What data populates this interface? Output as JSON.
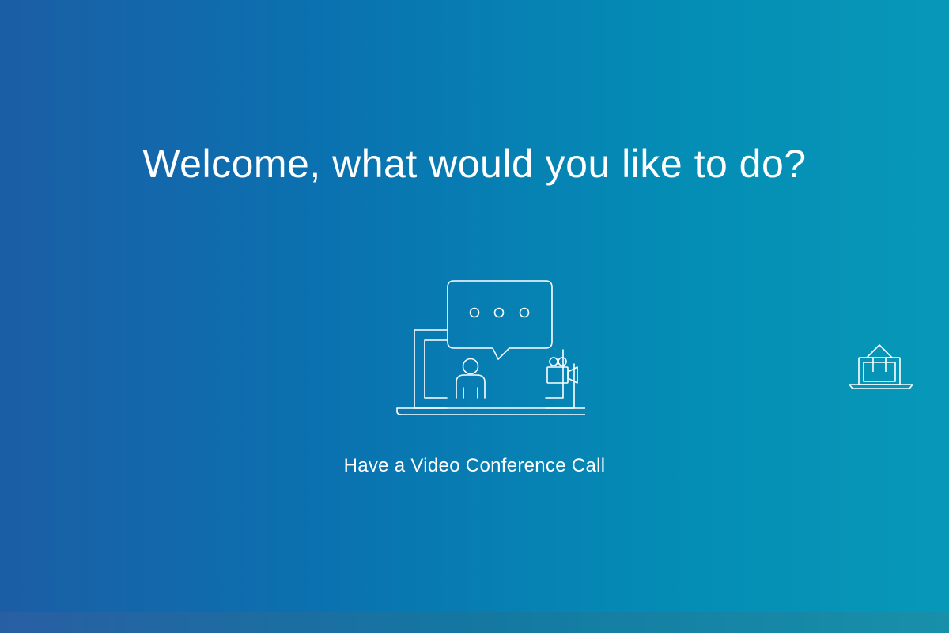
{
  "welcome": {
    "title": "Welcome, what would you like to do?"
  },
  "options": [
    {
      "label": "Have a Video Conference Call",
      "icon": "video-conference-icon"
    },
    {
      "label": "",
      "icon": "share-screen-icon"
    }
  ],
  "colors": {
    "background_start": "#1b5ea6",
    "background_end": "#0798b8",
    "foreground": "#ffffff"
  }
}
